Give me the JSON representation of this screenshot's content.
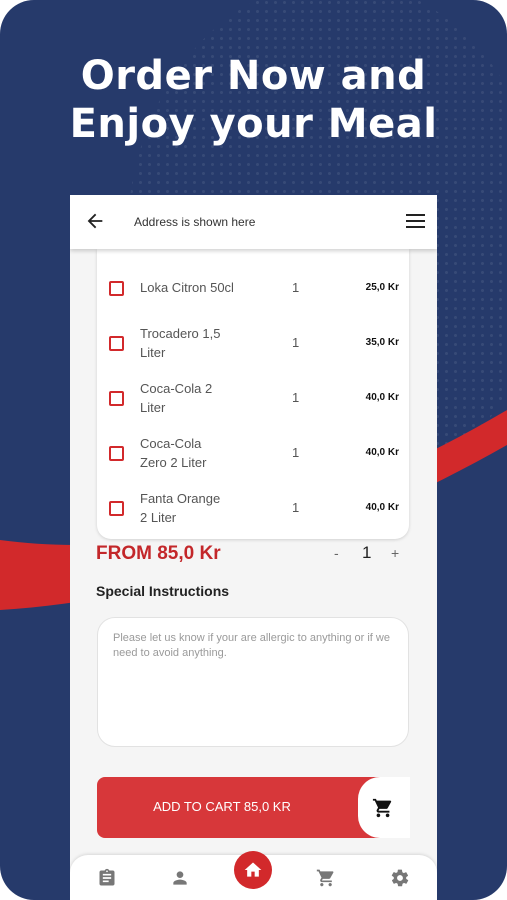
{
  "promo": {
    "headline_line1": "Order Now and",
    "headline_line2": "Enjoy your Meal"
  },
  "colors": {
    "background": "#263a6b",
    "accent": "#d2292b",
    "button": "#d7373a"
  },
  "appbar": {
    "address": "Address is shown here",
    "back_icon": "arrow-left-icon",
    "menu_icon": "hamburger-menu-icon"
  },
  "items": [
    {
      "name": "Loka Citron 50cl",
      "qty": "1",
      "price": "25,0 Kr"
    },
    {
      "name": "Trocadero 1,5 Liter",
      "qty": "1",
      "price": "35,0 Kr"
    },
    {
      "name": "Coca-Cola 2 Liter",
      "qty": "1",
      "price": "40,0 Kr"
    },
    {
      "name": "Coca-Cola Zero 2 Liter",
      "qty": "1",
      "price": "40,0 Kr"
    },
    {
      "name": "Fanta Orange 2 Liter",
      "qty": "1",
      "price": "40,0 Kr"
    }
  ],
  "summary": {
    "from_price": "FROM 85,0 Kr",
    "minus": "-",
    "quantity": "1",
    "plus": "+"
  },
  "instructions": {
    "label": "Special Instructions",
    "placeholder": "Please let us know if your are allergic to anything or if we need to avoid anything."
  },
  "cart_button": {
    "label": "ADD TO CART 85,0 KR",
    "icon": "shopping-cart-icon"
  },
  "bottom_nav": [
    "clipboard-icon",
    "person-icon",
    "home-icon",
    "shopping-cart-icon",
    "gear-icon"
  ]
}
